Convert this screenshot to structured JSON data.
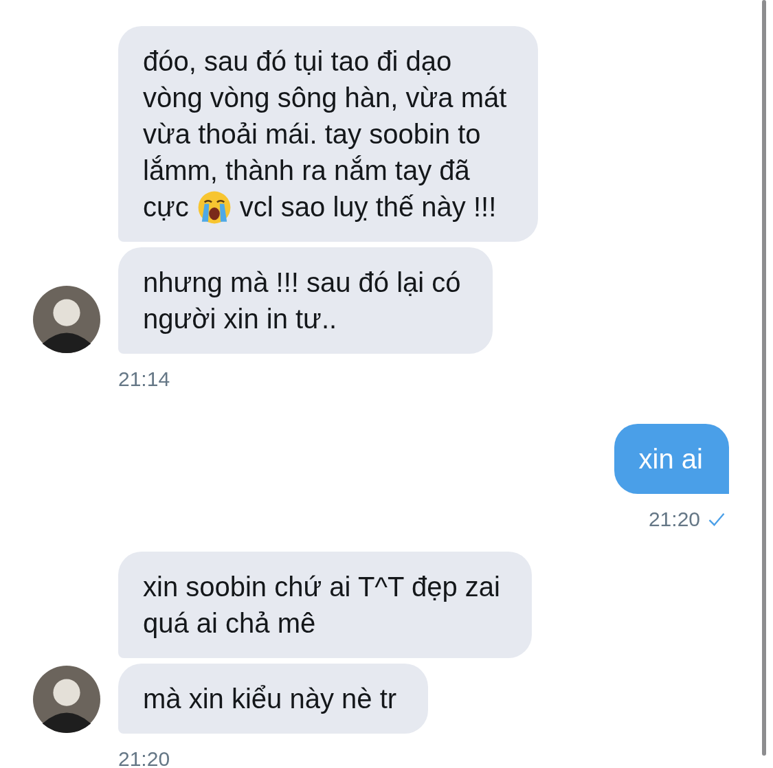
{
  "groups": [
    {
      "kind": "incoming",
      "messages": [
        {
          "rows": [
            [
              {
                "kind": "text",
                "text": "đóo, sau đó tụi tao đi dạo\nvòng vòng sông hàn, vừa mát\nvừa thoải mái. tay soobin to\nlắmm, thành ra nắm tay đã"
              }
            ],
            [
              {
                "kind": "text",
                "text": "cực"
              },
              {
                "kind": "emoji"
              },
              {
                "kind": "text",
                "text": "vcl sao luỵ thế này !!!"
              }
            ]
          ]
        },
        {
          "rows": [
            [
              {
                "kind": "text",
                "text": "nhưng mà !!! sau đó lại có\nngười xin in tư.."
              }
            ]
          ]
        }
      ],
      "time": "21:14"
    },
    {
      "kind": "outgoing",
      "messages": [
        {
          "rows": [
            [
              {
                "kind": "text",
                "text": "xin ai"
              }
            ]
          ]
        }
      ],
      "time": "21:20",
      "read": true
    },
    {
      "kind": "incoming",
      "messages": [
        {
          "rows": [
            [
              {
                "kind": "text",
                "text": "xin soobin chứ ai T^T đẹp zai\nquá ai chả mê"
              }
            ]
          ]
        },
        {
          "rows": [
            [
              {
                "kind": "text",
                "text": "mà xin kiểu này nè tr"
              }
            ]
          ]
        }
      ],
      "time": "21:20"
    }
  ]
}
